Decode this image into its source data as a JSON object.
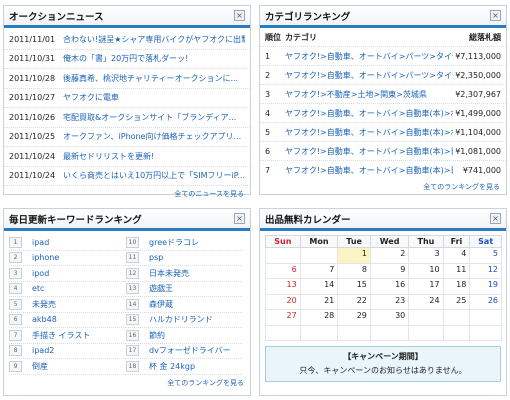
{
  "news": {
    "title": "オークションニュース",
    "close": "×",
    "items": [
      {
        "date": "2011/11/01",
        "title": "合わない!謎呈★シャア専用バイクがヤフオクに出撃中!"
      },
      {
        "date": "2011/10/31",
        "title": "俺木の「書」20万円で落札ダーッ!"
      },
      {
        "date": "2011/10/28",
        "title": "後藤真希、桃沢地チャリティーオークションに..."
      },
      {
        "date": "2011/10/27",
        "title": "ヤフオクに電車"
      },
      {
        "date": "2011/10/26",
        "title": "宅配買取&オークションサイト「ブランディア..."
      },
      {
        "date": "2011/10/25",
        "title": "オークファン、iPhone向け価格チェックアプリ..."
      },
      {
        "date": "2011/10/24",
        "title": "最新セドリリストを更新!"
      },
      {
        "date": "2011/10/24",
        "title": "いくら商売とはいえ10万円以上で「SIMフリーiP..."
      }
    ],
    "more": "全てのニュースを見る"
  },
  "category": {
    "title": "カテゴリランキング",
    "close": "×",
    "headers": {
      "rank": "順位",
      "name": "カテゴリ",
      "amount": "総落札額"
    },
    "rows": [
      {
        "rank": "1",
        "name": "ヤフオク!>自動車、オートバイ>パーツ>タイヤ・...",
        "amount": "¥7,113,000"
      },
      {
        "rank": "2",
        "name": "ヤフオク!>自動車、オートバイ>パーツ>タイヤ・...",
        "amount": "¥2,350,000"
      },
      {
        "rank": "3",
        "name": "ヤフオク!>不動産>土地>関東>茨城県",
        "amount": "¥2,307,967"
      },
      {
        "rank": "4",
        "name": "ヤフオク!>自動車、オートバイ>自動車(本)>ボル...",
        "amount": "¥1,499,000"
      },
      {
        "rank": "5",
        "name": "ヤフオク!>自動車、オートバイ>自動車(本)>ボル...",
        "amount": "¥1,104,000"
      },
      {
        "rank": "6",
        "name": "ヤフオク!>自動車、オートバイ>自動車(本)>日産...",
        "amount": "¥1,081,000"
      },
      {
        "rank": "7",
        "name": "ヤフオク!>自動車、オートバイ>自動車(本)>日産...",
        "amount": "¥741,000"
      }
    ],
    "more": "全てのランキングを見る"
  },
  "keywords": {
    "title": "毎日更新キーワードランキング",
    "close": "×",
    "left": [
      {
        "num": "1",
        "word": "ipad"
      },
      {
        "num": "2",
        "word": "iphone"
      },
      {
        "num": "3",
        "word": "ipod"
      },
      {
        "num": "4",
        "word": "etc"
      },
      {
        "num": "5",
        "word": "未発売"
      },
      {
        "num": "6",
        "word": "akb48"
      },
      {
        "num": "7",
        "word": "手描き イラスト"
      },
      {
        "num": "8",
        "word": "ipad2"
      },
      {
        "num": "9",
        "word": "倒産"
      }
    ],
    "right": [
      {
        "num": "10",
        "word": "greeドラコレ"
      },
      {
        "num": "11",
        "word": "psp"
      },
      {
        "num": "12",
        "word": "日本未発売"
      },
      {
        "num": "13",
        "word": "遊戯王"
      },
      {
        "num": "14",
        "word": "森伊蔵"
      },
      {
        "num": "15",
        "word": "ハルカドリランド"
      },
      {
        "num": "16",
        "word": "節約"
      },
      {
        "num": "17",
        "word": "dvフォーゼドライバー"
      },
      {
        "num": "18",
        "word": "杯 金 24kgp"
      }
    ],
    "more": "全てのランキングを見る"
  },
  "calendar": {
    "title": "出品無料カレンダー",
    "close": "×",
    "weekdays": [
      "Sun",
      "Mon",
      "Tue",
      "Wed",
      "Thu",
      "Fri",
      "Sat"
    ],
    "weeks": [
      [
        "",
        "",
        "1",
        "2",
        "3",
        "4",
        "5"
      ],
      [
        "6",
        "7",
        "8",
        "9",
        "10",
        "11",
        "12"
      ],
      [
        "13",
        "14",
        "15",
        "16",
        "17",
        "18",
        "19"
      ],
      [
        "20",
        "21",
        "22",
        "23",
        "24",
        "25",
        "26"
      ],
      [
        "27",
        "28",
        "29",
        "30",
        "",
        "",
        ""
      ],
      [
        "",
        "",
        "",
        "",
        "",
        "",
        ""
      ]
    ],
    "today": "1",
    "campaign_title": "【キャンペーン期間】",
    "campaign_text": "只今、キャンペーンのお知らせはありません。"
  }
}
